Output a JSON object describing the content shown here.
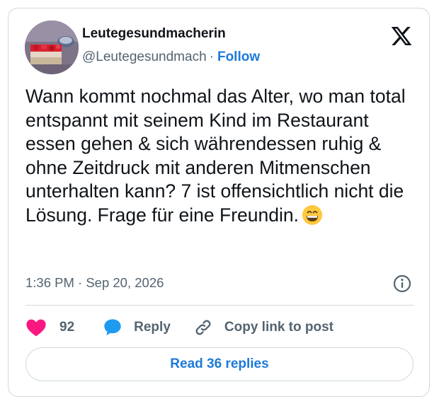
{
  "author": {
    "display_name": "Leutegesundmacherin",
    "handle": "@Leutegesundmach",
    "separator": "·",
    "follow_label": "Follow"
  },
  "post": {
    "text": "Wann kommt nochmal das Alter, wo man total entspannt mit seinem Kind im Restaurant essen gehen & sich währendessen ruhig & ohne Zeitdruck mit anderen Mitmenschen unterhalten kann? 7 ist offensichtlich nicht die Lösung. Frage für eine Freundin.",
    "emoji": "grinning-face-with-smiling-eyes",
    "timestamp": "1:36 PM · Sep 20, 2026"
  },
  "actions": {
    "like_count": "92",
    "reply_label": "Reply",
    "copy_label": "Copy link to post",
    "read_replies_label": "Read 36 replies"
  },
  "icons": {
    "platform": "x-logo-icon",
    "info": "info-icon",
    "like": "heart-icon",
    "reply": "speech-bubble-icon",
    "copy": "link-icon"
  },
  "colors": {
    "accent": "#1d7ad8",
    "like": "#f91880",
    "reply": "#1d9bf0",
    "muted": "#536471",
    "border": "#cfd9de"
  }
}
